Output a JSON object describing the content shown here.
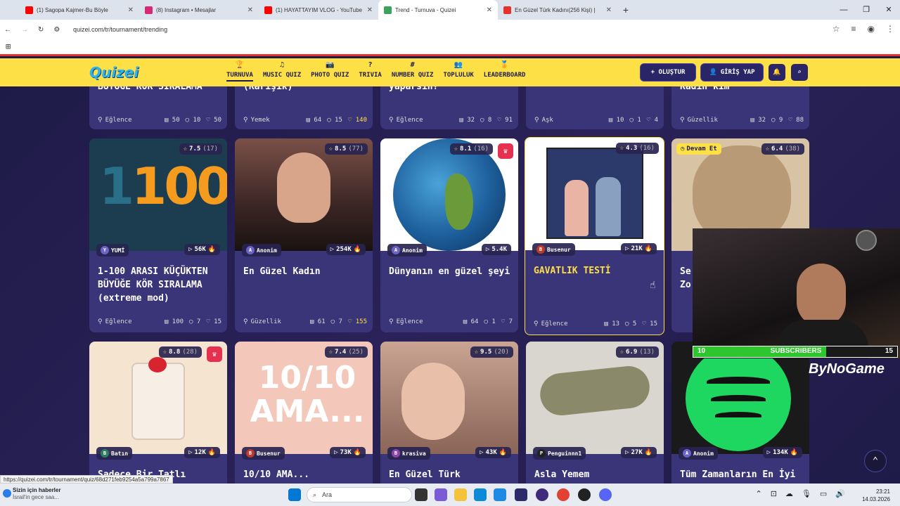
{
  "browser": {
    "tabs": [
      {
        "title": "(1) Sagopa Kajmer-Bu Böyle",
        "color": "#ff0000"
      },
      {
        "title": "(8) Instagram • Mesajlar",
        "color": "#d62976"
      },
      {
        "title": "(1) HAYATTAYIM VLOG - YouTube",
        "color": "#ff0000"
      },
      {
        "title": "Trend - Turnuva - Quizei",
        "color": "#3aa45c"
      },
      {
        "title": "En Güzel Türk Kadını(256 Kişi) |",
        "color": "#e5322d"
      }
    ],
    "url": "quizei.com/tr/tournament/trending"
  },
  "site": {
    "logo": "Quizei",
    "nav": [
      {
        "icon": "🏆",
        "label": "TURNUVA"
      },
      {
        "icon": "♫",
        "label": "MUSIC QUIZ"
      },
      {
        "icon": "📷",
        "label": "PHOTO QUIZ"
      },
      {
        "icon": "?",
        "label": "TRIVIA"
      },
      {
        "icon": "#",
        "label": "NUMBER QUIZ"
      },
      {
        "icon": "👥",
        "label": "TOPLULUK"
      },
      {
        "icon": "🏅",
        "label": "LEADERBOARD"
      }
    ],
    "create_label": "+ OLUŞTUR",
    "login_label": "GİRİŞ YAP"
  },
  "top_cards": [
    {
      "title": "BÜYÜĞE KÖR SIRALAMA",
      "cat": "Eğlence",
      "q": "50",
      "c": "10",
      "l": "50",
      "hot": false
    },
    {
      "title": "(Karışık)",
      "cat": "Yemek",
      "q": "64",
      "c": "15",
      "l": "140",
      "hot": true
    },
    {
      "title": "yaparsın?",
      "cat": "Eğlence",
      "q": "32",
      "c": "8",
      "l": "91",
      "hot": false
    },
    {
      "title": "",
      "cat": "Aşk",
      "q": "10",
      "c": "1",
      "l": "4",
      "hot": false
    },
    {
      "title": "Kadın kim",
      "cat": "Güzellik",
      "q": "32",
      "c": "9",
      "l": "88",
      "hot": false
    }
  ],
  "mid_cards": [
    {
      "rating": "7.5",
      "rcount": "(17)",
      "author": "YUMİ",
      "av": "Y",
      "plays": "56K",
      "title": "1-100 ARASI KÜÇÜKTEN BÜYÜĞE KÖR SIRALAMA (extreme mod)",
      "cat": "Eğlence",
      "q": "100",
      "c": "7",
      "l": "15",
      "hot": false,
      "bg": "#1c3d4f",
      "big": "1 100"
    },
    {
      "rating": "8.5",
      "rcount": "(77)",
      "author": "Anonim",
      "av": "A",
      "plays": "254K",
      "title": "En Güzel Kadın",
      "cat": "Güzellik",
      "q": "61",
      "c": "7",
      "l": "155",
      "hot": true,
      "bg": "#5a3a3a",
      "big": ""
    },
    {
      "rating": "8.1",
      "rcount": "(16)",
      "author": "Anonim",
      "av": "A",
      "plays": "5.4K",
      "title": "Dünyanın en güzel şeyi",
      "cat": "Eğlence",
      "q": "64",
      "c": "1",
      "l": "7",
      "hot": false,
      "bg": "#ffffff",
      "big": ""
    },
    {
      "rating": "4.3",
      "rcount": "(16)",
      "author": "Busenur",
      "av": "B",
      "plays": "21K",
      "title": "GAVATLIK TESTİ",
      "cat": "Eğlence",
      "q": "13",
      "c": "5",
      "l": "15",
      "hot": false,
      "bg": "#ffffff",
      "big": ""
    },
    {
      "badge": "Devam Et",
      "rating": "6.4",
      "rcount": "(38)",
      "author": "Anonim",
      "av": "A",
      "plays": "",
      "title": "Se... Zo...",
      "cat": "",
      "q": "",
      "c": "",
      "l": "",
      "hot": false,
      "bg": "#d9c3a5",
      "big": ""
    }
  ],
  "bottom_cards": [
    {
      "rating": "8.8",
      "rcount": "(28)",
      "author": "Batın",
      "av": "B",
      "plays": "12K",
      "title": "Sadece Bir Tatlı",
      "bg": "#f4e4d0",
      "big": ""
    },
    {
      "rating": "7.4",
      "rcount": "(25)",
      "author": "Busenur",
      "av": "B",
      "plays": "73K",
      "title": "10/10 AMA...",
      "bg": "#f3c8bb",
      "big": "10/10 AMA..."
    },
    {
      "rating": "9.5",
      "rcount": "(20)",
      "author": "krasiva",
      "av": "B",
      "plays": "43K",
      "title": "En Güzel Türk",
      "bg": "#d9b7a7",
      "big": ""
    },
    {
      "rating": "6.9",
      "rcount": "(13)",
      "author": "Penguinnn1",
      "av": "P",
      "plays": "27K",
      "title": "Asla Yemem",
      "bg": "#d9d6d0",
      "big": ""
    },
    {
      "rating": "",
      "rcount": "",
      "author": "Anonim",
      "av": "A",
      "plays": "134K",
      "title": "Tüm Zamanların En İyi",
      "bg": "#1a1a1a",
      "big": ""
    }
  ],
  "stream": {
    "sub_left": "10",
    "sub_label": "SUBSCRIBERS",
    "sub_right": "15",
    "sub_progress": 0.65,
    "brand": "ByNoGame"
  },
  "status_url": "https://quizei.com/tr/tournament/quiz/68d271feb9254a5a799a7867",
  "taskbar": {
    "news_title": "Sizin için haberler",
    "news_sub": "İsrail'in gece saa...",
    "search": "Ara",
    "time": "23:21",
    "date": "14.03.2026"
  }
}
